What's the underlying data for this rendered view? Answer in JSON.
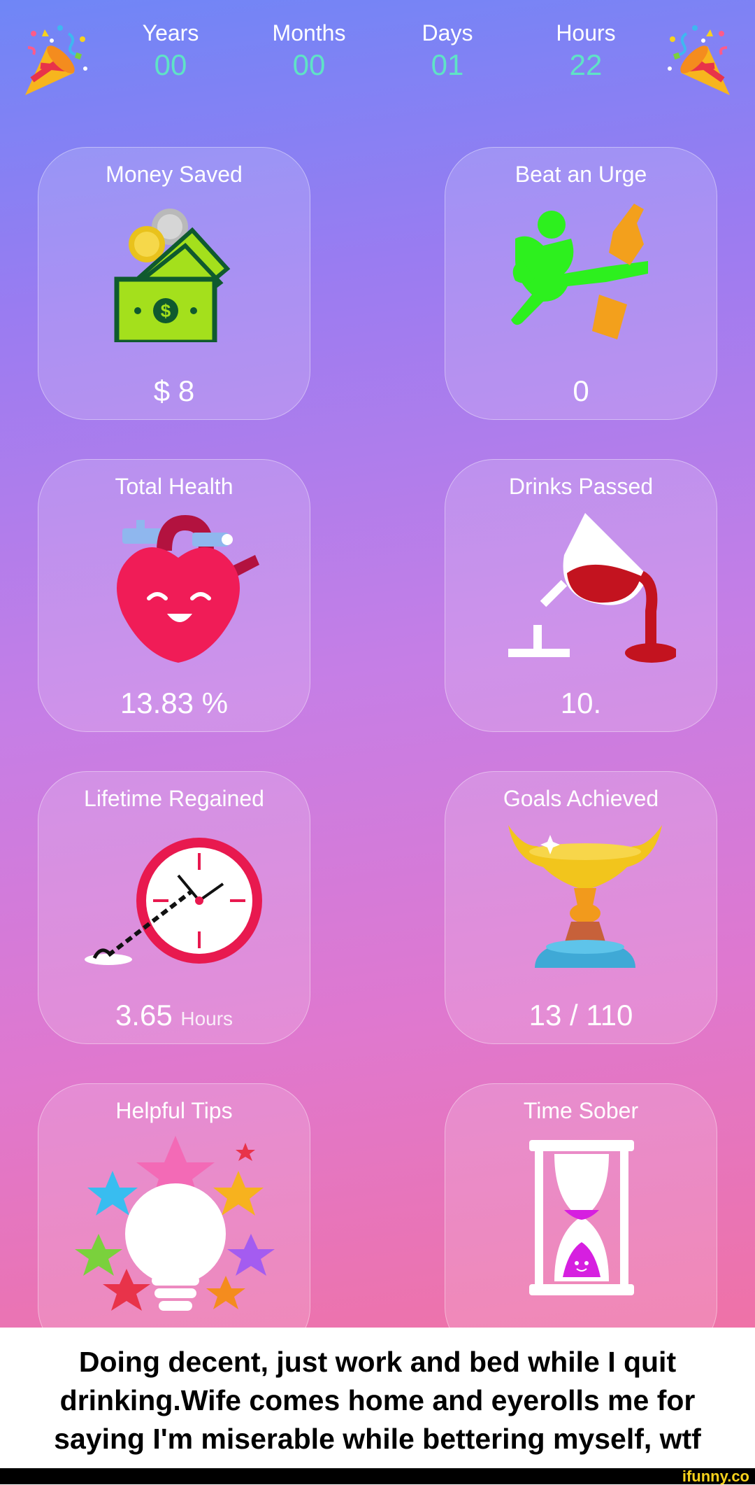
{
  "counter": {
    "years_label": "Years",
    "years_value": "00",
    "months_label": "Months",
    "months_value": "00",
    "days_label": "Days",
    "days_value": "01",
    "hours_label": "Hours",
    "hours_value": "22"
  },
  "cards": {
    "money_saved": {
      "title": "Money Saved",
      "value": "$ 8",
      "icon": "money-icon"
    },
    "beat_urge": {
      "title": "Beat an Urge",
      "value": "0",
      "icon": "kick-bottle-icon"
    },
    "total_health": {
      "title": "Total Health",
      "value": "13.83 %",
      "icon": "heart-icon"
    },
    "drinks_passed": {
      "title": "Drinks Passed",
      "value": "10.",
      "icon": "spilled-wine-icon"
    },
    "lifetime_regained": {
      "title": "Lifetime Regained",
      "value": "3.65",
      "unit": "Hours",
      "icon": "chained-clock-icon"
    },
    "goals_achieved": {
      "title": "Goals Achieved",
      "value": "13 / 110",
      "icon": "trophy-icon"
    },
    "helpful_tips": {
      "title": "Helpful Tips",
      "icon": "lightbulb-stars-icon"
    },
    "time_sober": {
      "title": "Time Sober",
      "icon": "hourglass-icon"
    }
  },
  "caption": {
    "line1": "Doing decent, just work and bed while I quit",
    "line2": "drinking.Wife comes home and eyerolls me for",
    "line3": "saying I'm miserable while bettering myself, wtf"
  },
  "watermark": "ifunny.co",
  "colors": {
    "counter_value": "#5fe3c6",
    "gradient_top": "#6f86f6",
    "gradient_bottom": "#ef72a7"
  }
}
